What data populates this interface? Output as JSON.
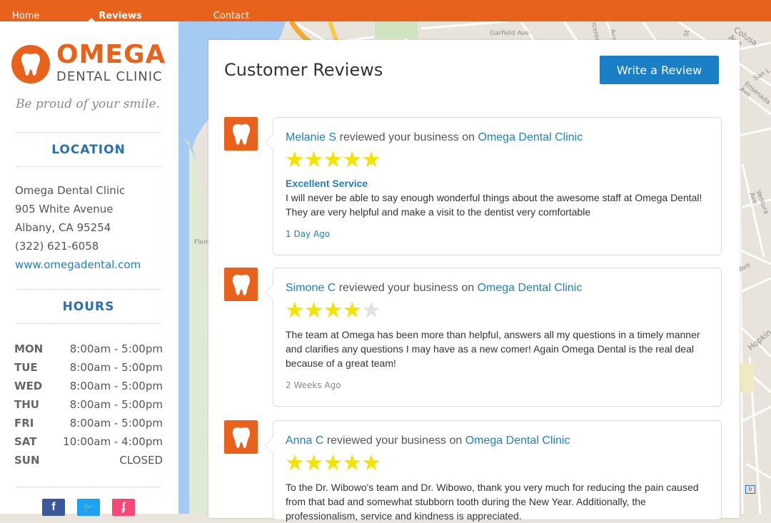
{
  "nav": {
    "items": [
      "Home",
      "Reviews",
      "Contact"
    ]
  },
  "brand": {
    "name": "OMEGA",
    "sub": "DENTAL CLINIC",
    "tagline": "Be proud of your smile.",
    "color": "#e8621c"
  },
  "location": {
    "heading": "LOCATION",
    "lines": [
      "Omega Dental Clinic",
      "905 White Avenue",
      "Albany, CA 95254",
      "(322) 621-6058"
    ],
    "website": "www.omegadental.com"
  },
  "hours": {
    "heading": "HOURS",
    "rows": [
      {
        "day": "MON",
        "time": "8:00am - 5:00pm"
      },
      {
        "day": "TUE",
        "time": "8:00am - 5:00pm"
      },
      {
        "day": "WED",
        "time": "8:00am - 5:00pm"
      },
      {
        "day": "THU",
        "time": "8:00am - 5:00pm"
      },
      {
        "day": "FRI",
        "time": "8:00am - 5:00pm"
      },
      {
        "day": "SAT",
        "time": "10:00am - 4:00pm"
      },
      {
        "day": "SUN",
        "time": "CLOSED"
      }
    ]
  },
  "social": [
    {
      "icon": "facebook-icon",
      "glyph": "f",
      "color": "#3b5998"
    },
    {
      "icon": "twitter-icon",
      "glyph": "🐦",
      "color": "#1da1f2"
    },
    {
      "icon": "foursquare-icon",
      "glyph": "ʄ",
      "color": "#f94877"
    }
  ],
  "map_labels": [
    "Garfield Ave",
    "Colusa Ave",
    "San L",
    "Ensenada Ave",
    "Ventura Ave",
    "Hopkin",
    "Flem",
    "Ave",
    "St",
    "Vincente Ave",
    "Ave"
  ],
  "reviews_panel": {
    "title": "Customer Reviews",
    "write_button": "Write a Review",
    "connector": "reviewed your business on",
    "reviews": [
      {
        "name": "Melanie S",
        "business": "Omega Dental Clinic",
        "rating": 5,
        "title": "Excellent Service",
        "body": "I will never be able to say enough wonderful things about the awesome staff at Omega Dental! They are very helpful and make a visit to the dentist very comfortable",
        "time": "1 Day Ago"
      },
      {
        "name": "Simone C",
        "business": "Omega Dental Clinic",
        "rating": 4,
        "title": "",
        "body": "The team at Omega has been more than helpful, answers all my questions in a timely manner and clarifies any questions I may have as a new comer! Again Omega Dental is the real deal because of a great team!",
        "time": "2 Weeks Ago"
      },
      {
        "name": "Anna C",
        "business": "Omega Dental Clinic",
        "rating": 5,
        "title": "",
        "body": "To the Dr. Wibowo's team and Dr. Wibowo, thank you very much for reducing the pain caused from that bad and somewhat stubborn tooth during the New Year. Additionally, the professionalism, service and kindness is appreciated.",
        "time": ""
      }
    ]
  },
  "colors": {
    "accent": "#e8621c",
    "link": "#1f7fc4",
    "button": "#1a7fc4",
    "star": "#f2e400"
  }
}
